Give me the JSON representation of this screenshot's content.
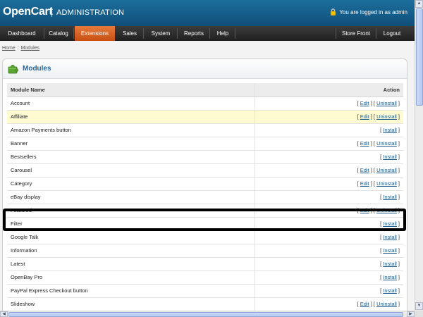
{
  "header": {
    "logo": "OpenCart",
    "title": "ADMINISTRATION",
    "login_text": "You are logged in as admin"
  },
  "menu": {
    "left": [
      "Dashboard",
      "Catalog",
      "Extensions",
      "Sales",
      "System",
      "Reports",
      "Help"
    ],
    "right": [
      "Store Front",
      "Logout"
    ],
    "active": "Extensions"
  },
  "breadcrumb": {
    "home": "Home",
    "separator": "::",
    "current": "Modules"
  },
  "box": {
    "title": "Modules"
  },
  "table": {
    "col_name": "Module Name",
    "col_action": "Action",
    "edit_label": "Edit",
    "uninstall_label": "Uninstall",
    "install_label": "Install",
    "rows": [
      {
        "name": "Account",
        "installed": true
      },
      {
        "name": "Affiliate",
        "installed": true,
        "highlighted": true
      },
      {
        "name": "Amazon Payments button",
        "installed": false
      },
      {
        "name": "Banner",
        "installed": true
      },
      {
        "name": "Bestsellers",
        "installed": false
      },
      {
        "name": "Carousel",
        "installed": true
      },
      {
        "name": "Category",
        "installed": true
      },
      {
        "name": "eBay display",
        "installed": false
      },
      {
        "name": "Featured",
        "installed": true
      },
      {
        "name": "Filter",
        "installed": false
      },
      {
        "name": "Google Talk",
        "installed": false
      },
      {
        "name": "Information",
        "installed": false
      },
      {
        "name": "Latest",
        "installed": false
      },
      {
        "name": "OpenBay Pro",
        "installed": false
      },
      {
        "name": "PayPal Express Checkout button",
        "installed": false
      },
      {
        "name": "Slideshow",
        "installed": true
      }
    ]
  },
  "colors": {
    "header": "#1d6e9c",
    "menu": "#2a2a2a",
    "menu_active": "#d9622a",
    "title_blue": "#1f66a0",
    "row_highlight": "#fffbd0"
  },
  "icons": {
    "lock": "lock-icon",
    "module": "puzzle-icon"
  }
}
